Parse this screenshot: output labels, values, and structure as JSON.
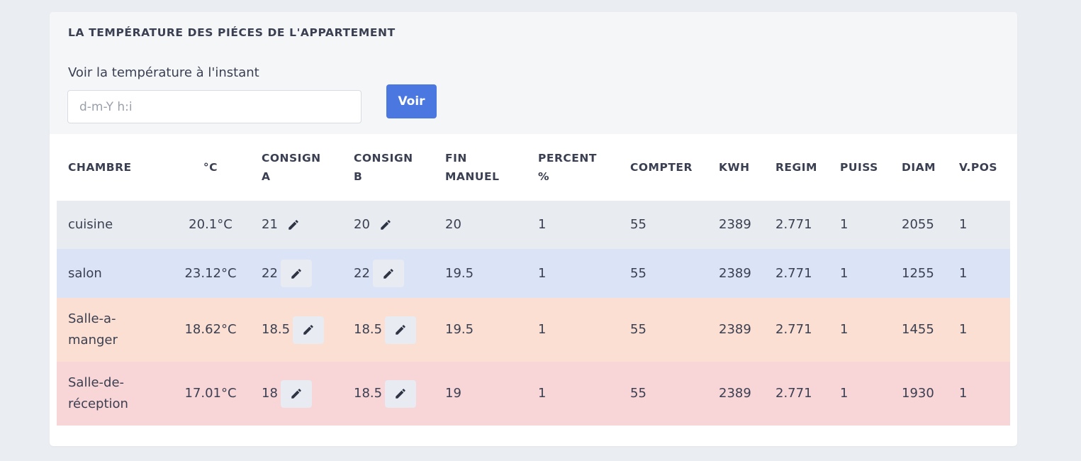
{
  "card": {
    "title": "LA TEMPÉRATURE DES PIÉCES DE L'APPARTEMENT",
    "filter_label": "Voir la température à l'instant",
    "date_placeholder": "d-m-Y h:i",
    "date_value": "",
    "submit_label": "Voir"
  },
  "table": {
    "headers": {
      "chambre": "CHAMBRE",
      "temp": "°C",
      "consign_a": "CONSIGN A",
      "consign_b": "CONSIGN B",
      "fin_manuel": "FIN MANUEL",
      "percent": "PERCENT %",
      "compter": "COMPTER",
      "kwh": "KWH",
      "regim": "REGIM",
      "puiss": "PUISS",
      "diam": "DIAM",
      "vpos": "V.POS"
    },
    "rows": [
      {
        "chambre": "cuisine",
        "temp": "20.1°C",
        "consign_a": "21",
        "consign_b": "20",
        "fin_manuel": "20",
        "percent": "1",
        "compter": "55",
        "kwh": "2389",
        "regim": "2.771",
        "puiss": "1",
        "diam": "2055",
        "vpos": "1",
        "color": "#e8ebef"
      },
      {
        "chambre": "salon",
        "temp": "23.12°C",
        "consign_a": "22",
        "consign_b": "22",
        "fin_manuel": "19.5",
        "percent": "1",
        "compter": "55",
        "kwh": "2389",
        "regim": "2.771",
        "puiss": "1",
        "diam": "1255",
        "vpos": "1",
        "color": "#dbe3f7"
      },
      {
        "chambre": "Salle-a-manger",
        "temp": "18.62°C",
        "consign_a": "18.5",
        "consign_b": "18.5",
        "fin_manuel": "19.5",
        "percent": "1",
        "compter": "55",
        "kwh": "2389",
        "regim": "2.771",
        "puiss": "1",
        "diam": "1455",
        "vpos": "1",
        "color": "#fbdfd2"
      },
      {
        "chambre": "Salle-de-réception",
        "temp": "17.01°C",
        "consign_a": "18",
        "consign_b": "18.5",
        "fin_manuel": "19",
        "percent": "1",
        "compter": "55",
        "kwh": "2389",
        "regim": "2.771",
        "puiss": "1",
        "diam": "1930",
        "vpos": "1",
        "color": "#f8d5d6"
      }
    ]
  },
  "icons": {
    "edit": "pencil-icon"
  },
  "colors": {
    "accent": "#4a78e0",
    "background": "#eaedf2"
  }
}
